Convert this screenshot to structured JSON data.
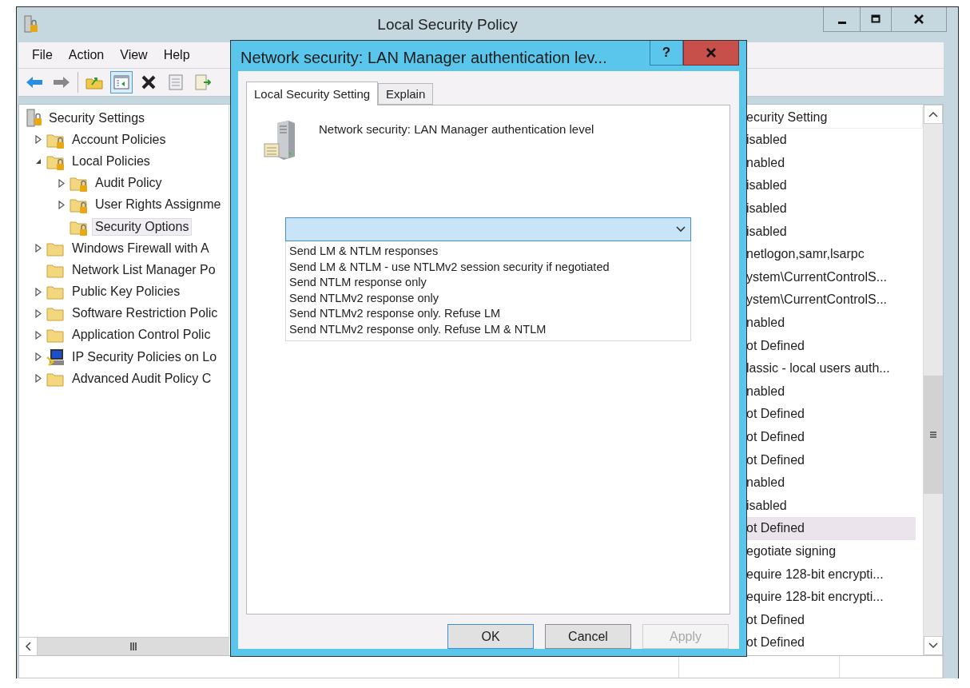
{
  "window": {
    "title": "Local Security Policy"
  },
  "menu": [
    "File",
    "Action",
    "View",
    "Help"
  ],
  "tree": [
    {
      "label": "Security Settings",
      "kind": "root",
      "selected": false,
      "children": [
        {
          "label": "Account Policies",
          "kind": "locked-folder",
          "expanded": false,
          "selected": false
        },
        {
          "label": "Local Policies",
          "kind": "locked-folder",
          "expanded": true,
          "selected": false,
          "children": [
            {
              "label": "Audit Policy",
              "kind": "locked-folder",
              "expanded": false,
              "selected": false
            },
            {
              "label": "User Rights Assignme",
              "kind": "locked-folder",
              "expanded": false,
              "selected": false
            },
            {
              "label": "Security Options",
              "kind": "locked-folder",
              "selected": true
            }
          ]
        },
        {
          "label": "Windows Firewall with A",
          "kind": "folder",
          "expanded": false,
          "selected": false
        },
        {
          "label": "Network List Manager Po",
          "kind": "folder",
          "selected": false
        },
        {
          "label": "Public Key Policies",
          "kind": "folder",
          "expanded": false,
          "selected": false
        },
        {
          "label": "Software Restriction Polic",
          "kind": "folder",
          "expanded": false,
          "selected": false
        },
        {
          "label": "Application Control Polic",
          "kind": "folder",
          "expanded": false,
          "selected": false
        },
        {
          "label": "IP Security Policies on Lo",
          "kind": "network",
          "expanded": false,
          "selected": false
        },
        {
          "label": "Advanced Audit Policy C",
          "kind": "folder",
          "expanded": false,
          "selected": false
        }
      ]
    }
  ],
  "settings": {
    "header": "ecurity Setting",
    "rows": [
      {
        "text": "isabled",
        "selected": false
      },
      {
        "text": "nabled",
        "selected": false
      },
      {
        "text": "isabled",
        "selected": false
      },
      {
        "text": "isabled",
        "selected": false
      },
      {
        "text": "isabled",
        "selected": false
      },
      {
        "text": "netlogon,samr,lsarpc",
        "selected": false
      },
      {
        "text": "ystem\\CurrentControlS...",
        "selected": false
      },
      {
        "text": "ystem\\CurrentControlS...",
        "selected": false
      },
      {
        "text": "nabled",
        "selected": false
      },
      {
        "text": "ot Defined",
        "selected": false
      },
      {
        "text": "lassic - local users auth...",
        "selected": false
      },
      {
        "text": "nabled",
        "selected": false
      },
      {
        "text": "ot Defined",
        "selected": false
      },
      {
        "text": "ot Defined",
        "selected": false
      },
      {
        "text": "ot Defined",
        "selected": false
      },
      {
        "text": "nabled",
        "selected": false
      },
      {
        "text": "isabled",
        "selected": false
      },
      {
        "text": "ot Defined",
        "selected": true
      },
      {
        "text": "egotiate signing",
        "selected": false
      },
      {
        "text": "equire 128-bit encrypti...",
        "selected": false
      },
      {
        "text": "equire 128-bit encrypti...",
        "selected": false
      },
      {
        "text": "ot Defined",
        "selected": false
      },
      {
        "text": "ot Defined",
        "selected": false
      }
    ]
  },
  "dialog": {
    "title": "Network security: LAN Manager authentication lev...",
    "help": "?",
    "tabs": [
      {
        "label": "Local Security Setting",
        "selected": true
      },
      {
        "label": "Explain",
        "selected": false
      }
    ],
    "description": "Network security: LAN Manager authentication level",
    "dropdown": {
      "expanded": true,
      "options": [
        "Send LM & NTLM responses",
        "Send LM & NTLM - use NTLMv2 session security if negotiated",
        "Send NTLM response only",
        "Send NTLMv2 response only",
        "Send NTLMv2 response only. Refuse LM",
        "Send NTLMv2 response only. Refuse LM & NTLM"
      ]
    },
    "buttons": [
      {
        "label": "OK",
        "kind": "default",
        "disabled": false
      },
      {
        "label": "Cancel",
        "kind": "normal",
        "disabled": false
      },
      {
        "label": "Apply",
        "kind": "normal",
        "disabled": true
      }
    ]
  }
}
